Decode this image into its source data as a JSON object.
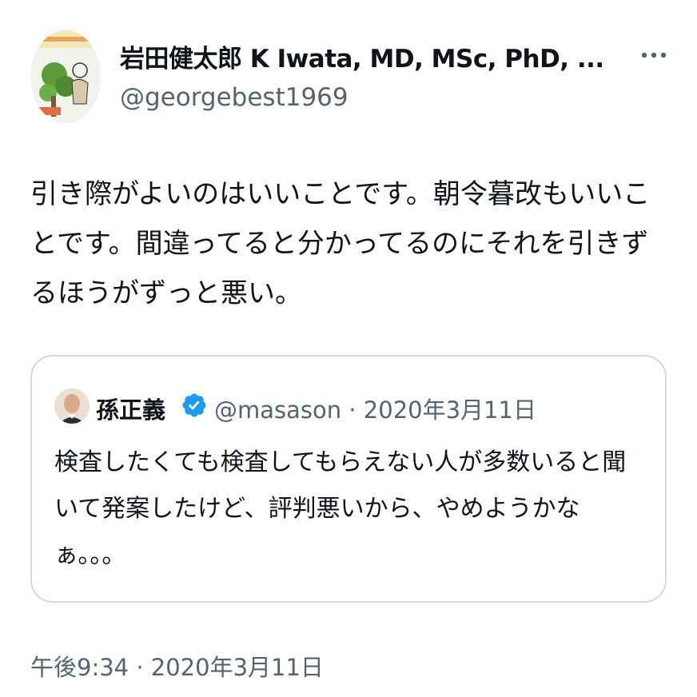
{
  "author": {
    "name": "岩田健太郎 K Iwata, MD, MSc, PhD, ...",
    "handle": "@georgebest1969",
    "avatar_icon": "avatar-illustration-icon",
    "more_icon": "more-options-icon"
  },
  "tweet": {
    "text": "引き際がよいのはいいことです。朝令暮改もいいことです。間違ってると分かってるのにそれを引きずるほうがずっと悪い。"
  },
  "quoted_tweet": {
    "name": "孫正義",
    "handle_date": "@masason · 2020年3月11日",
    "verified_icon": "verified-badge-icon",
    "verified_color": "#1d9bf0",
    "text": "検査したくても検査してもらえない人が多数いると聞いて発案したけど、評判悪いから、やめようかなぁ。。。"
  },
  "meta": {
    "timestamp": "午後9:34 · 2020年3月11日"
  },
  "colors": {
    "text_primary": "#0f1419",
    "text_secondary": "#536471",
    "border": "#cfd9de"
  }
}
